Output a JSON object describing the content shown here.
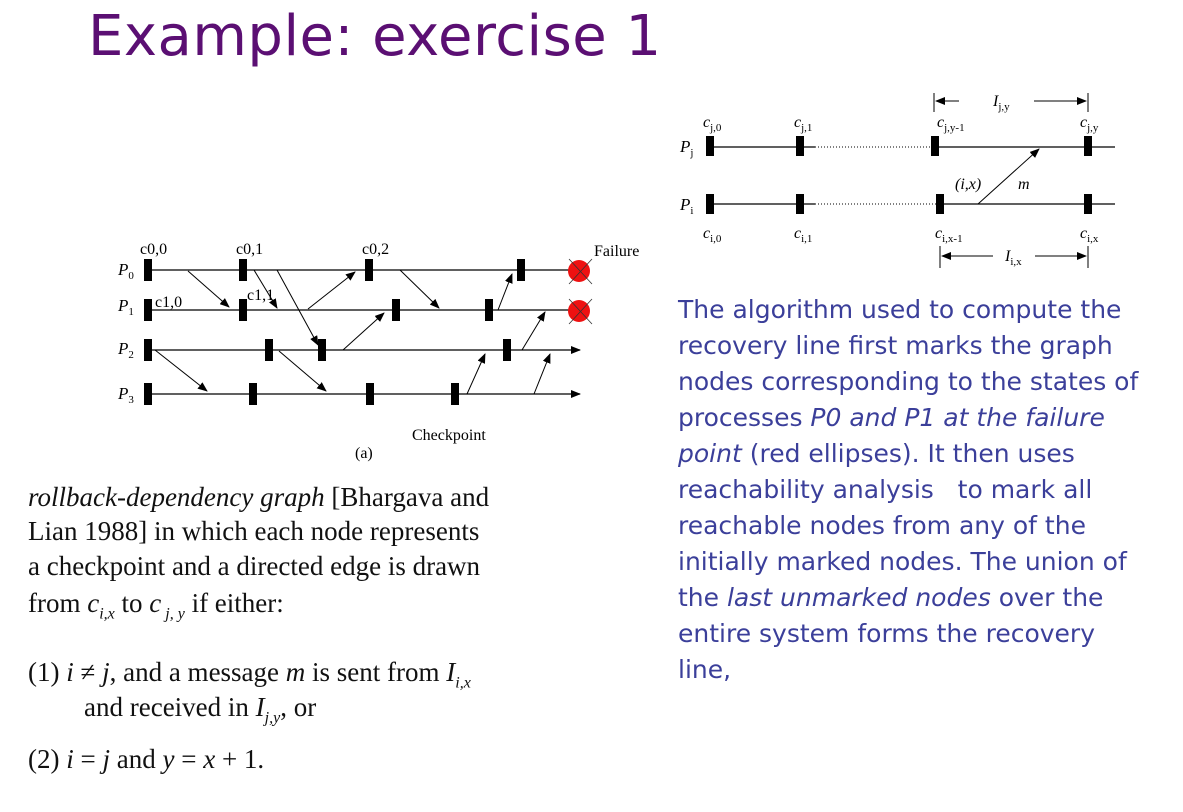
{
  "slide": {
    "title": "Example: exercise 1"
  },
  "diagram_a": {
    "processes": [
      "P0",
      "P1",
      "P2",
      "P3"
    ],
    "checkpoint_labels": {
      "c00": "c0,0",
      "c01": "c0,1",
      "c02": "c0,2",
      "c10": "c1,0",
      "c11": "c1,1"
    },
    "failure_label": "Failure",
    "checkpoint_label": "Checkpoint",
    "caption": "(a)",
    "failure_color": "#ee1111"
  },
  "diagram_b": {
    "processes": [
      "Pj",
      "Pi"
    ],
    "top_labels": [
      "cj,0",
      "cj,1",
      "cj,y-1",
      "cj,y"
    ],
    "bottom_labels": [
      "ci,0",
      "ci,1",
      "ci,x-1",
      "ci,x"
    ],
    "interval_top": "Ij,y",
    "interval_bottom": "Ii,x",
    "message_label": "(i,x)",
    "message_name": "m"
  },
  "left_text": {
    "line1_term": "rollback-dependency graph",
    "line1_rest": " [Bhargava and",
    "line2": "Lian 1988] in which each node represents",
    "line3": "a checkpoint and a directed edge is drawn",
    "line4_a": "from ",
    "line4_b": " to ",
    "line4_c": " if either:",
    "cond1_a": "(1) ",
    "cond1_b": ", and a message ",
    "cond1_c": " is sent from ",
    "cond1_d": "and received in ",
    "cond1_e": ", or",
    "cond2_a": "(2) ",
    "cond2_b": " and ",
    "cond2_c": "."
  },
  "right_text": {
    "l1": "The algorithm used to compute the",
    "l2": "recovery line first marks the graph",
    "l3": "nodes corresponding to the states of",
    "l4_a": "processes ",
    "l4_b": "P0 and P1 at the failure",
    "l5_a": "point",
    "l5_b": " (red ellipses). It then uses",
    "l6": "reachability analysis   to mark all",
    "l7": "reachable nodes from any of the",
    "l8": "initially marked nodes. The union of",
    "l9_a": "the ",
    "l9_b": "last unmarked nodes",
    "l9_c": " over the",
    "l10": "entire system forms the recovery",
    "l11": "line,"
  }
}
